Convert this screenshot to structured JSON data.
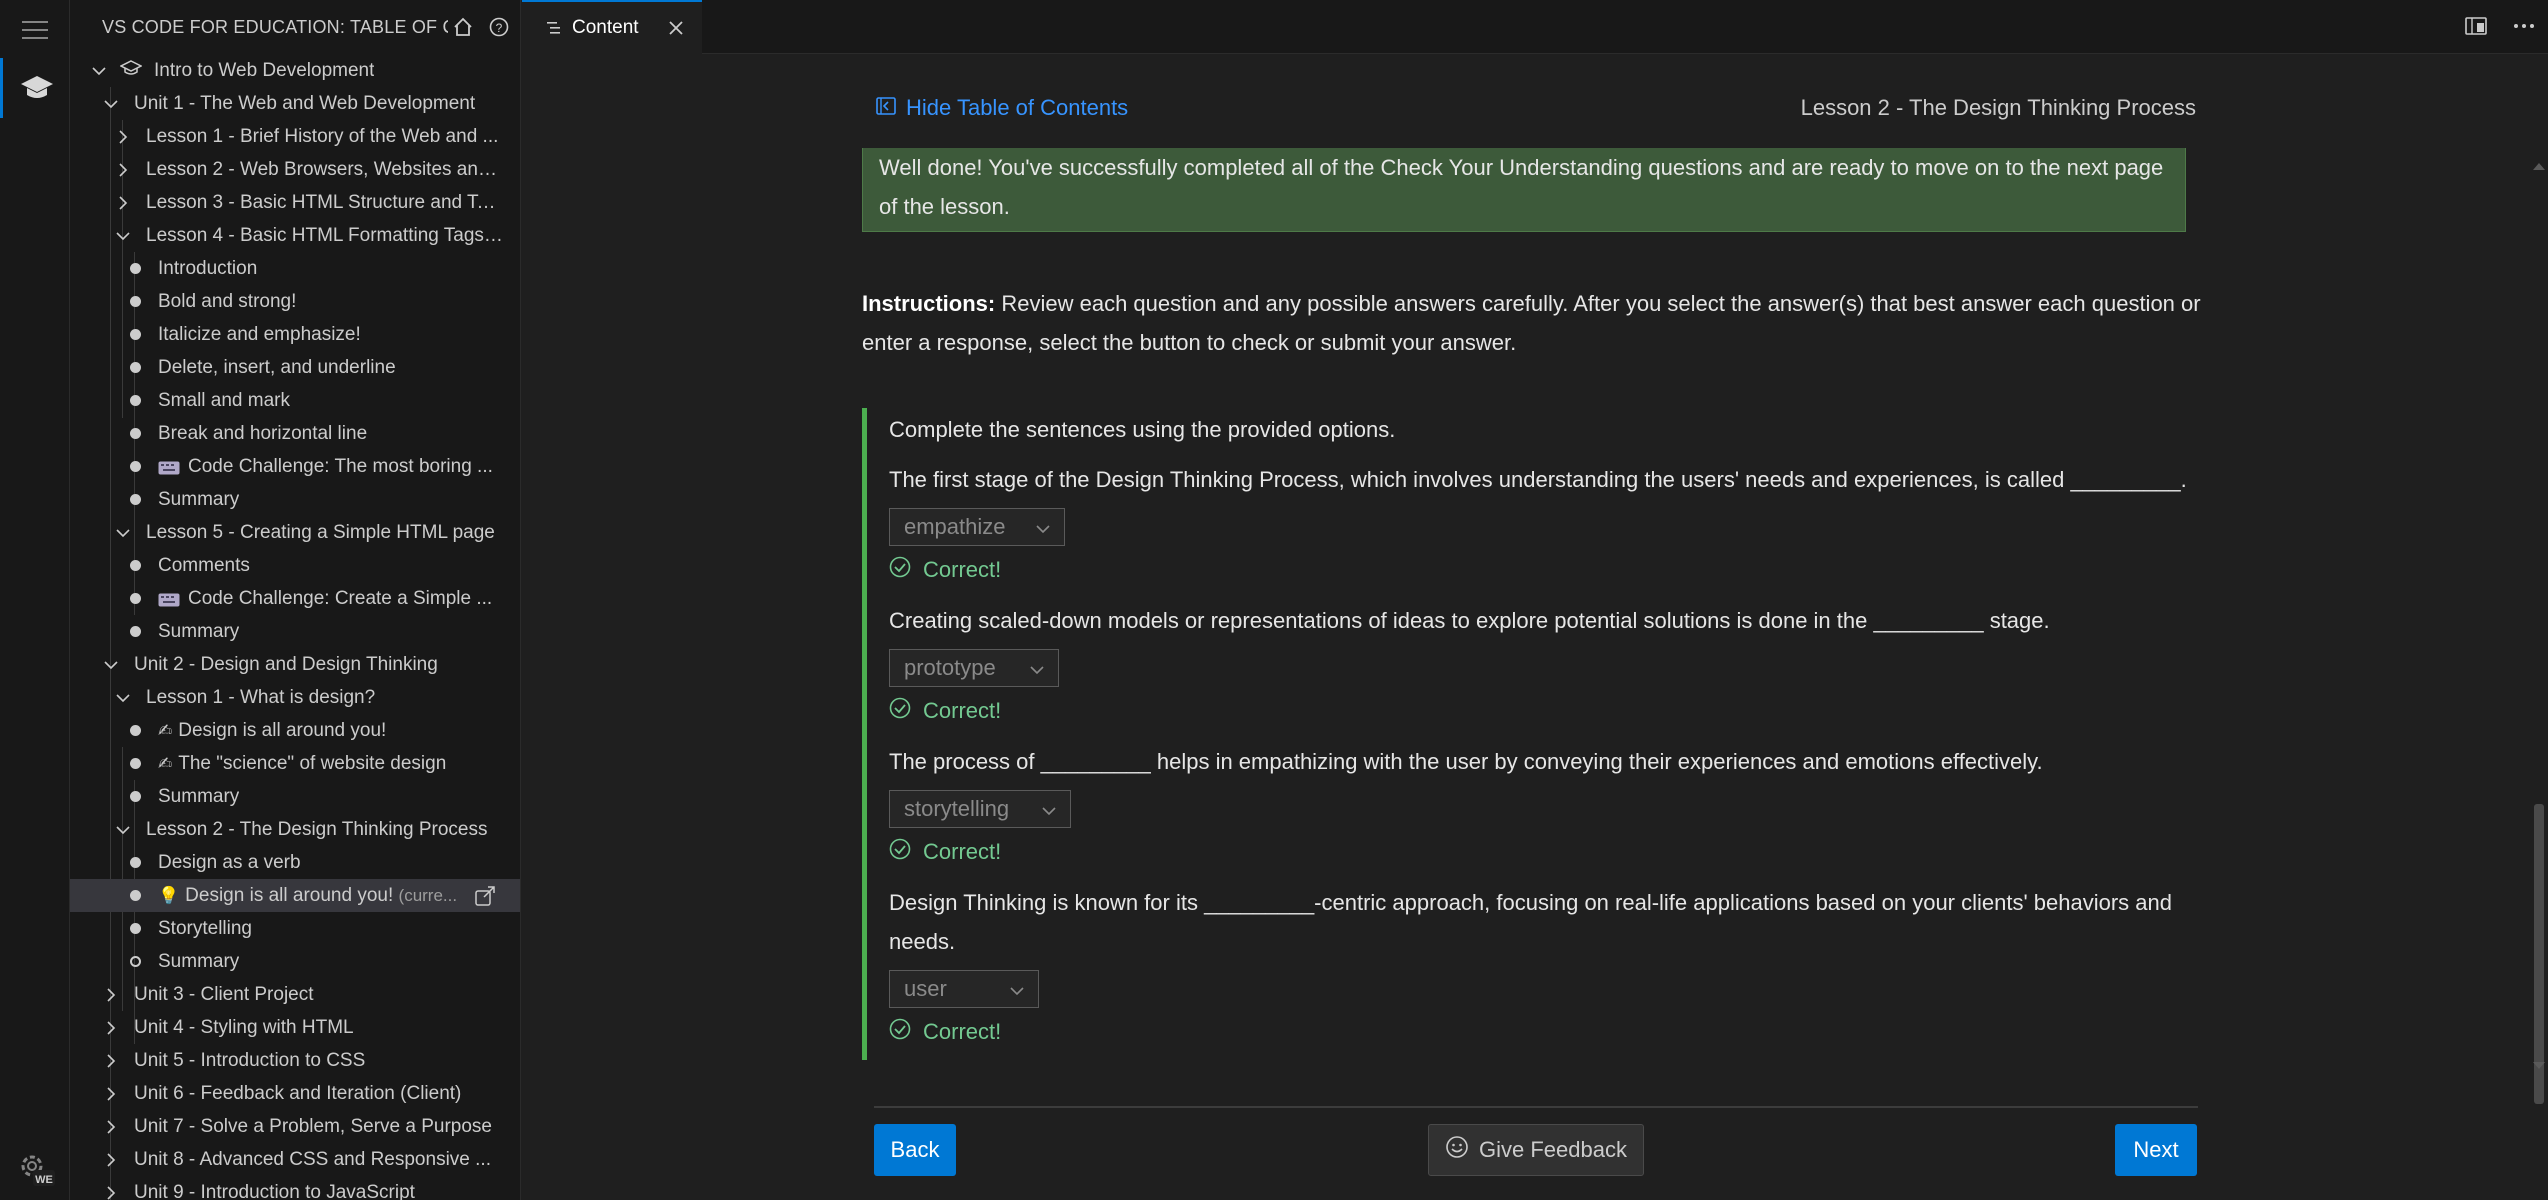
{
  "sidebar": {
    "title": "VS CODE FOR EDUCATION: TABLE OF CON...",
    "root": "Intro to Web Development",
    "unit1": "Unit 1 - The Web and Web Development",
    "u1_lessons": [
      "Lesson 1 - Brief History of the Web and ...",
      "Lesson 2 - Web Browsers, Websites and...",
      "Lesson 3 - Basic HTML Structure and Tags",
      "Lesson 4 - Basic HTML Formatting Tags ..."
    ],
    "lesson4_items": [
      "Introduction",
      "Bold and strong!",
      "Italicize and emphasize!",
      "Delete, insert, and underline",
      "Small and mark",
      "Break and horizontal line",
      "Code Challenge: The most boring ...",
      "Summary"
    ],
    "lesson5": "Lesson 5 - Creating a Simple HTML page",
    "lesson5_items": [
      "Comments",
      "Code Challenge: Create a Simple ...",
      "Summary"
    ],
    "unit2": "Unit 2 - Design and Design Thinking",
    "u2_lesson1": "Lesson 1 - What is design?",
    "u2_lesson1_items": [
      "Design is all around you!",
      "The \"science\" of website design",
      "Summary"
    ],
    "u2_lesson2": "Lesson 2 - The Design Thinking Process",
    "u2_lesson2_items": [
      "Design as a verb",
      "Design is all around you!",
      "Storytelling",
      "Summary"
    ],
    "current_label": "(curre...",
    "units": [
      "Unit 3 - Client Project",
      "Unit 4 - Styling with HTML",
      "Unit 5 - Introduction to CSS",
      "Unit 6 - Feedback and Iteration (Client)",
      "Unit 7 - Solve a Problem, Serve a Purpose",
      "Unit 8 - Advanced CSS and Responsive ...",
      "Unit 9 - Introduction to JavaScript"
    ]
  },
  "tab": {
    "label": "Content"
  },
  "content": {
    "hide_toc": "Hide Table of Contents",
    "lesson_title": "Lesson 2 - The Design Thinking Process",
    "success_message": "Well done! You've successfully completed all of the Check Your Understanding questions and are ready to move on to the next page of the lesson.",
    "instructions_label": "Instructions:",
    "instructions_text": " Review each question and any possible answers carefully. After you select the answer(s) that best answer each question or enter a response, select the button to check or submit your answer.",
    "prompt": "Complete the sentences using the provided options.",
    "questions": [
      {
        "text": "The first stage of the Design Thinking Process, which involves understanding the users' needs and experiences, is called _________.",
        "answer": "empathize",
        "result": "Correct!"
      },
      {
        "text": "Creating scaled-down models or representations of ideas to explore potential solutions is done in the _________ stage.",
        "answer": "prototype",
        "result": "Correct!"
      },
      {
        "text": "The process of _________ helps in empathizing with the user by conveying their experiences and emotions effectively.",
        "answer": "storytelling",
        "result": "Correct!"
      },
      {
        "text": "Design Thinking is known for its _________-centric approach, focusing on real-life applications based on your clients' behaviors and needs.",
        "answer": "user",
        "result": "Correct!"
      }
    ],
    "back_label": "Back",
    "feedback_label": "Give Feedback",
    "next_label": "Next"
  },
  "badge": "WE",
  "colors": {
    "accent": "#0078d4",
    "success": "#73c991",
    "link": "#3794ff"
  }
}
